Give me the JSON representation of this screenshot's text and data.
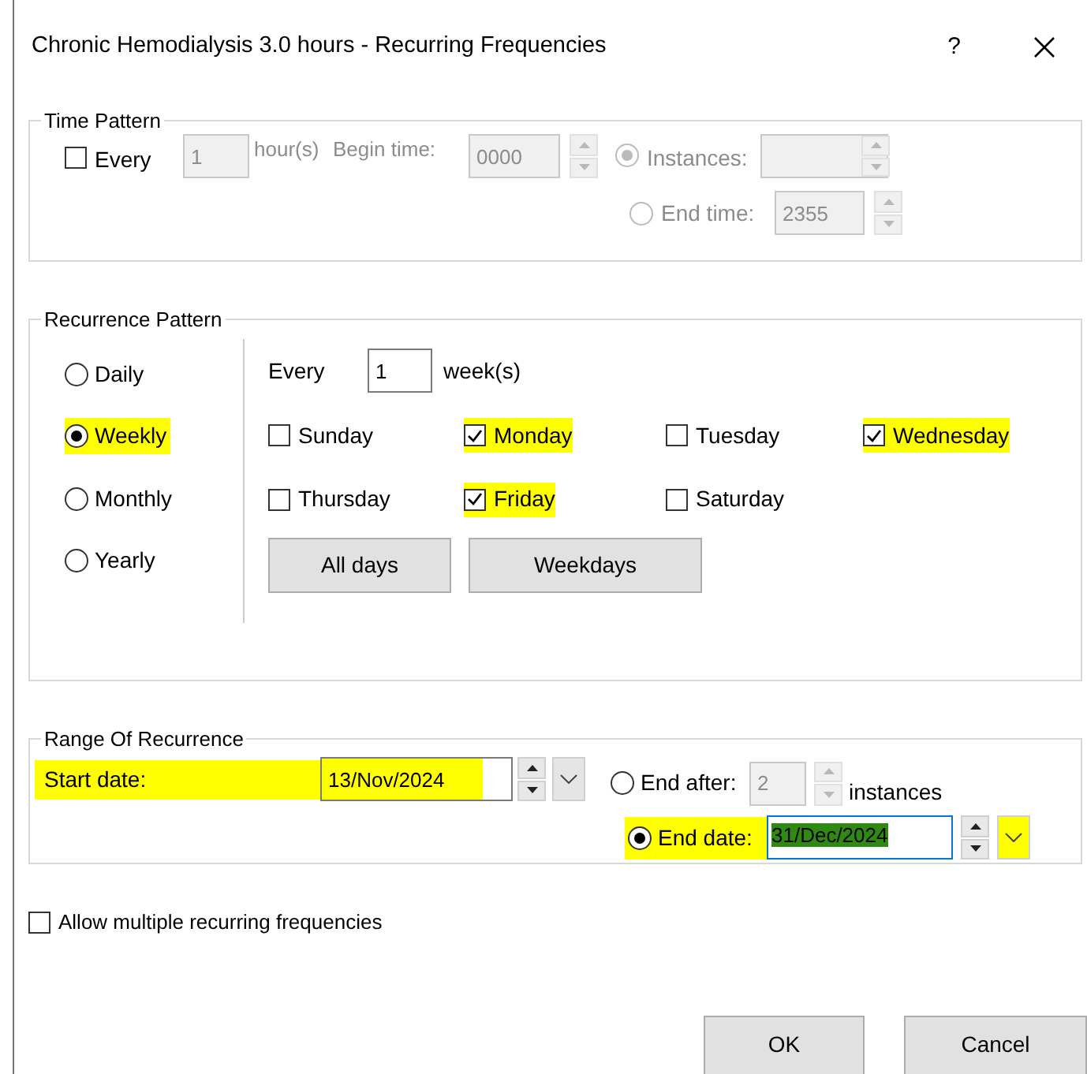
{
  "window": {
    "title": "Chronic Hemodialysis 3.0 hours - Recurring Frequencies",
    "help": "?"
  },
  "time_pattern": {
    "title": "Time Pattern",
    "disabled": true,
    "every": {
      "label": "Every",
      "checked": false
    },
    "hours": {
      "value": "1",
      "unit": "hour(s)"
    },
    "begin_time": {
      "label": "Begin time:",
      "value": "0000"
    },
    "end_modes": [
      {
        "kind": "instances",
        "label": "Instances:",
        "selected": true
      },
      {
        "kind": "time",
        "label": "End time:",
        "selected": false,
        "value": "2355"
      }
    ]
  },
  "recurrence": {
    "title": "Recurrence Pattern",
    "frequencies": [
      {
        "label": "Daily",
        "selected": false,
        "highlighted": false
      },
      {
        "label": "Weekly",
        "selected": true,
        "highlighted": true
      },
      {
        "label": "Monthly",
        "selected": false,
        "highlighted": false
      },
      {
        "label": "Yearly",
        "selected": false,
        "highlighted": false
      }
    ],
    "every_label": "Every",
    "every_value": "1",
    "unit": "week(s)",
    "days": [
      {
        "label": "Sunday",
        "checked": false,
        "highlighted": false
      },
      {
        "label": "Monday",
        "checked": true,
        "highlighted": true
      },
      {
        "label": "Tuesday",
        "checked": false,
        "highlighted": false
      },
      {
        "label": "Wednesday",
        "checked": true,
        "highlighted": true
      },
      {
        "label": "Thursday",
        "checked": false,
        "highlighted": false
      },
      {
        "label": "Friday",
        "checked": true,
        "highlighted": true
      },
      {
        "label": "Saturday",
        "checked": false,
        "highlighted": false
      }
    ],
    "buttons": [
      "All days",
      "Weekdays"
    ]
  },
  "range": {
    "title": "Range Of Recurrence",
    "start_date": {
      "label": "Start date:",
      "value": "13/Nov/2024",
      "highlighted": true
    },
    "end_options": [
      {
        "kind": "after",
        "label": "End after:",
        "selected": false,
        "value": "2",
        "suffix": "instances",
        "disabled": true
      },
      {
        "kind": "date",
        "label": "End date:",
        "selected": true,
        "value": "31/Dec/2024",
        "highlighted": true,
        "focused": true
      }
    ]
  },
  "allow_multiple": {
    "label": "Allow multiple recurring frequencies",
    "checked": false
  },
  "buttons": [
    "OK",
    "Cancel"
  ]
}
